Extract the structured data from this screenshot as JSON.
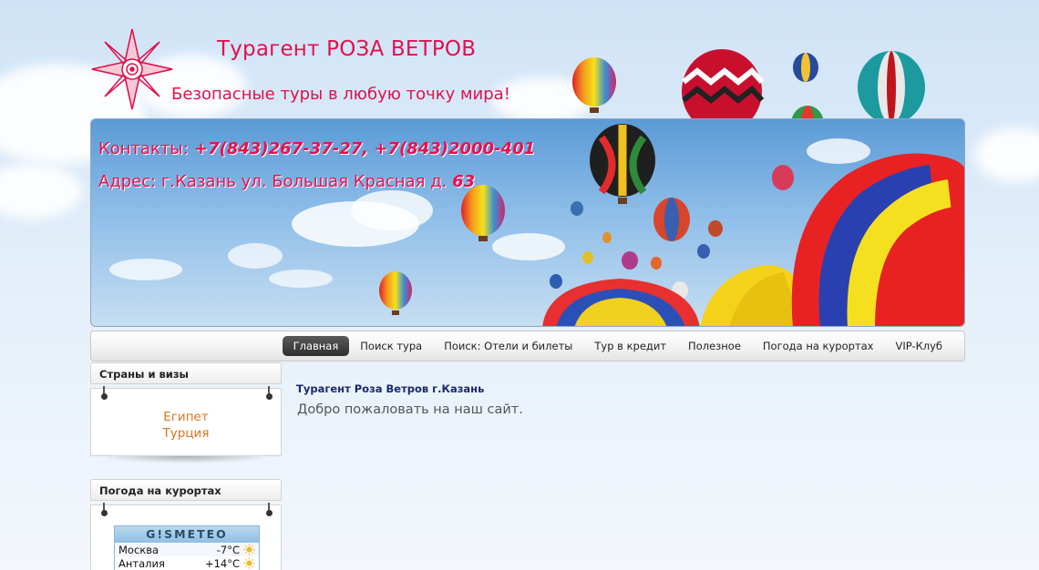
{
  "header": {
    "title": "Турагент РОЗА ВЕТРОВ",
    "slogan": "Безопасные туры в любую точку мира!"
  },
  "banner": {
    "contacts_label": "Контакты:",
    "contacts_phones": "+7(843)267-37-27, +7(843)2000-401",
    "address_label": "Адрес: г.Казань ул. Большая Красная д.",
    "address_number": "63"
  },
  "nav": {
    "items": [
      "Главная",
      "Поиск тура",
      "Поиск: Отели и билеты",
      "Тур в кредит",
      "Полезное",
      "Погода на курортах",
      "VIP-Клуб"
    ],
    "active_index": 0
  },
  "sidebar": {
    "countries": {
      "title": "Страны и визы",
      "items": [
        "Египет",
        "Турция"
      ]
    },
    "weather": {
      "title": "Погода на курортах",
      "brand": "G!SMETEO",
      "rows": [
        {
          "city": "Москва",
          "temp": "-7°C"
        },
        {
          "city": "Анталия",
          "temp": "+14°C"
        }
      ]
    }
  },
  "content": {
    "title": "Турагент Роза Ветров г.Казань",
    "text": "Добро пожаловать на наш сайт."
  },
  "colors": {
    "brand": "#e0114c",
    "link": "#e07520",
    "heading": "#1a2a6c"
  }
}
